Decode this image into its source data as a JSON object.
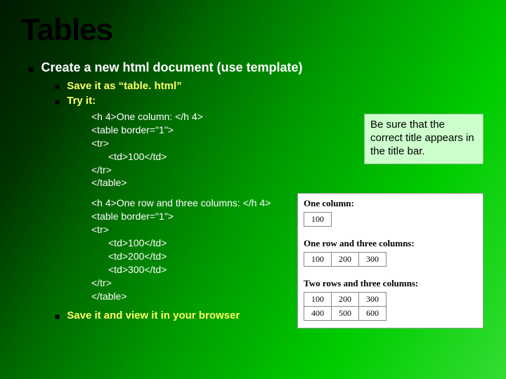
{
  "title": "Tables",
  "lvl1_text": "Create a new html document (use template)",
  "lvl2a": "Save it as “table. html”",
  "lvl2b": "Try it:",
  "code1": {
    "l1": "<h 4>One column: </h 4>",
    "l2": "<table border=\"1\">",
    "l3": "<tr>",
    "l4": "<td>100</td>",
    "l5": "</tr>",
    "l6": "</table>"
  },
  "code2": {
    "l1": "<h 4>One row and three columns: </h 4>",
    "l2": "<table border=\"1\">",
    "l3": "<tr>",
    "l4": "<td>100</td>",
    "l5": "<td>200</td>",
    "l6": "<td>300</td>",
    "l7": "</tr>",
    "l8": "</table>"
  },
  "lvl2c": "Save it and view it in your browser",
  "callout": "Be sure that the correct title appears in the title bar.",
  "example": {
    "h1": "One column:",
    "t1": {
      "r1c1": "100"
    },
    "h2": "One row and three columns:",
    "t2": {
      "r1c1": "100",
      "r1c2": "200",
      "r1c3": "300"
    },
    "h3": "Two rows and three columns:",
    "t3": {
      "r1c1": "100",
      "r1c2": "200",
      "r1c3": "300",
      "r2c1": "400",
      "r2c2": "500",
      "r2c3": "600"
    }
  }
}
